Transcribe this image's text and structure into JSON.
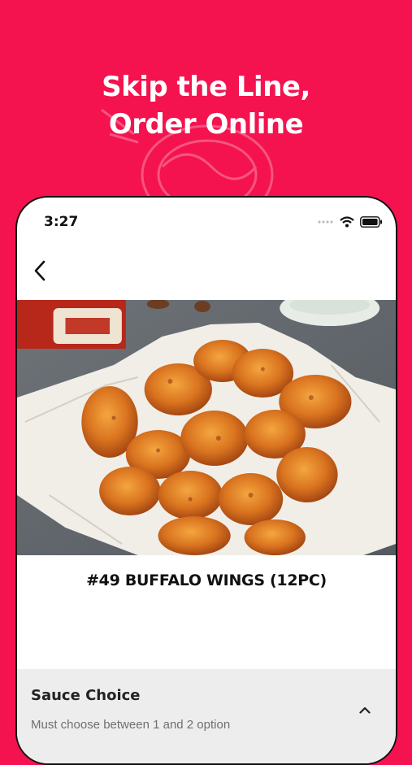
{
  "promo": {
    "headline_line1": "Skip the Line,",
    "headline_line2": "Order Online"
  },
  "colors": {
    "brand": "#F4134F",
    "section_bg": "#EDEDED"
  },
  "status_bar": {
    "time": "3:27",
    "icons": [
      "signal-dots-icon",
      "wifi-icon",
      "battery-icon"
    ]
  },
  "nav": {
    "back_icon": "chevron-left-icon"
  },
  "product": {
    "image": "buffalo-wings-photo",
    "title": "#49 BUFFALO WINGS (12PC)"
  },
  "options": {
    "group_title": "Sauce Choice",
    "group_subtitle": "Must choose between 1 and 2 option",
    "toggle_icon": "chevron-up-icon"
  }
}
